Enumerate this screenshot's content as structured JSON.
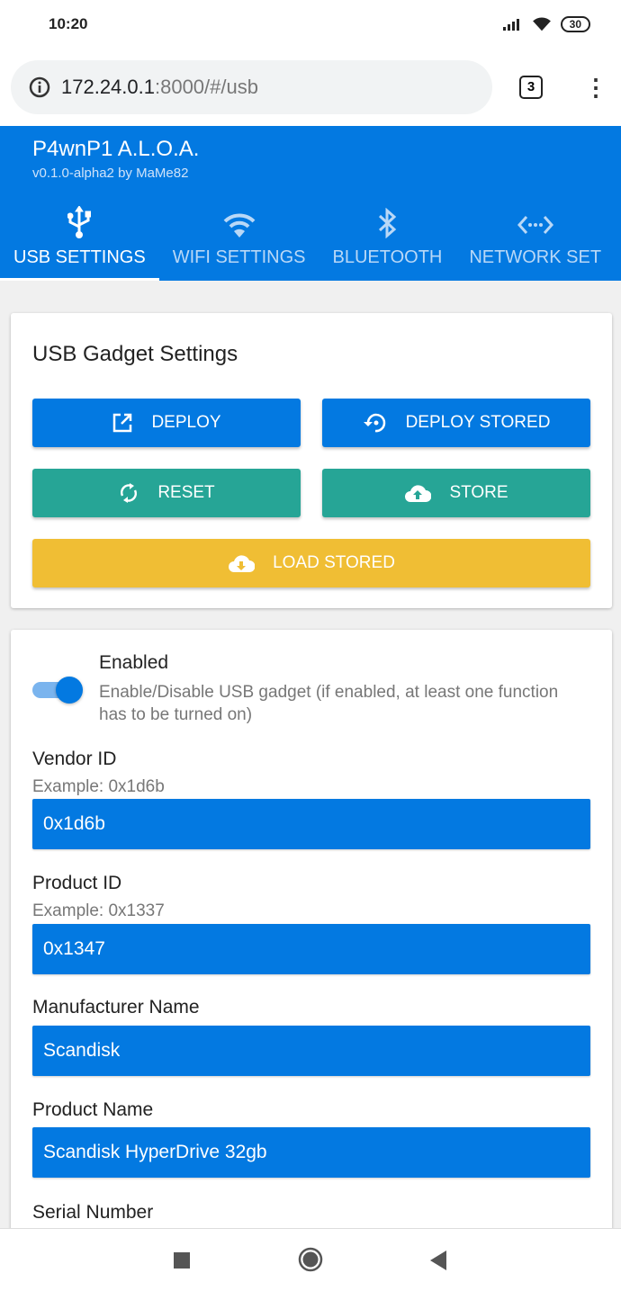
{
  "status": {
    "time": "10:20",
    "battery": "30"
  },
  "browser": {
    "url_host": "172.24.0.1",
    "url_rest": ":8000/#/usb",
    "tab_count": "3"
  },
  "app": {
    "title": "P4wnP1 A.L.O.A.",
    "subtitle": "v0.1.0-alpha2 by MaMe82"
  },
  "tabs": [
    {
      "label": "USB SETTINGS",
      "icon": "usb-icon",
      "active": true
    },
    {
      "label": "WIFI SETTINGS",
      "icon": "wifi-icon"
    },
    {
      "label": "BLUETOOTH",
      "icon": "bluetooth-icon"
    },
    {
      "label": "NETWORK SET",
      "icon": "network-icon"
    }
  ],
  "gadget_card": {
    "title": "USB Gadget Settings",
    "buttons": {
      "deploy": "DEPLOY",
      "deploy_stored": "DEPLOY STORED",
      "reset": "RESET",
      "store": "STORE",
      "load_stored": "LOAD STORED"
    }
  },
  "colors": {
    "primary": "#0379e1",
    "teal": "#26a596",
    "yellow": "#f0be34"
  },
  "settings": {
    "enabled": {
      "label": "Enabled",
      "description": "Enable/Disable USB gadget (if enabled, at least one function has to be turned on)",
      "value": true
    },
    "vendor_id": {
      "label": "Vendor ID",
      "hint": "Example: 0x1d6b",
      "value": "0x1d6b"
    },
    "product_id": {
      "label": "Product ID",
      "hint": "Example: 0x1337",
      "value": "0x1347"
    },
    "manufacturer": {
      "label": "Manufacturer Name",
      "value": "Scandisk"
    },
    "product_name": {
      "label": "Product Name",
      "value": "Scandisk HyperDrive 32gb"
    },
    "serial": {
      "label": "Serial Number"
    }
  }
}
